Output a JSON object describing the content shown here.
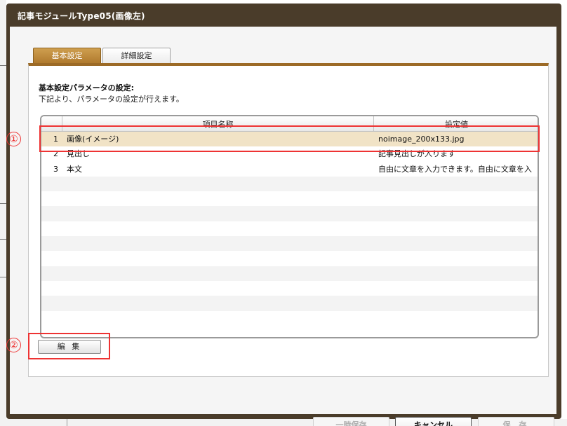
{
  "dialog": {
    "title": "記事モジュールType05(画像左)"
  },
  "tabs": [
    {
      "label": "基本設定",
      "active": true
    },
    {
      "label": "詳細設定",
      "active": false
    }
  ],
  "panel": {
    "heading": "基本設定パラメータの設定:",
    "description": "下記より、パラメータの設定が行えます。"
  },
  "grid": {
    "columns": {
      "number": "",
      "name": "項目名称",
      "value": "設定値"
    },
    "rows": [
      {
        "num": "1",
        "name": "画像(イメージ)",
        "value": "noimage_200x133.jpg",
        "selected": true
      },
      {
        "num": "2",
        "name": "見出し",
        "value": "記事見出しが入ります",
        "selected": false
      },
      {
        "num": "3",
        "name": "本文",
        "value": "自由に文章を入力できます。自由に文章を入",
        "selected": false
      }
    ],
    "empty_row_count": 10
  },
  "annotations": [
    {
      "label": "①"
    },
    {
      "label": "②"
    }
  ],
  "buttons": {
    "edit": "編 集",
    "temp_save": "一時保存",
    "cancel": "キャンセル",
    "save": "保 存"
  },
  "colors": {
    "frame": "#4a3c2a",
    "accent": "#9c6a26",
    "selected_row": "#f1e3c6",
    "annotation": "#ee3333"
  }
}
